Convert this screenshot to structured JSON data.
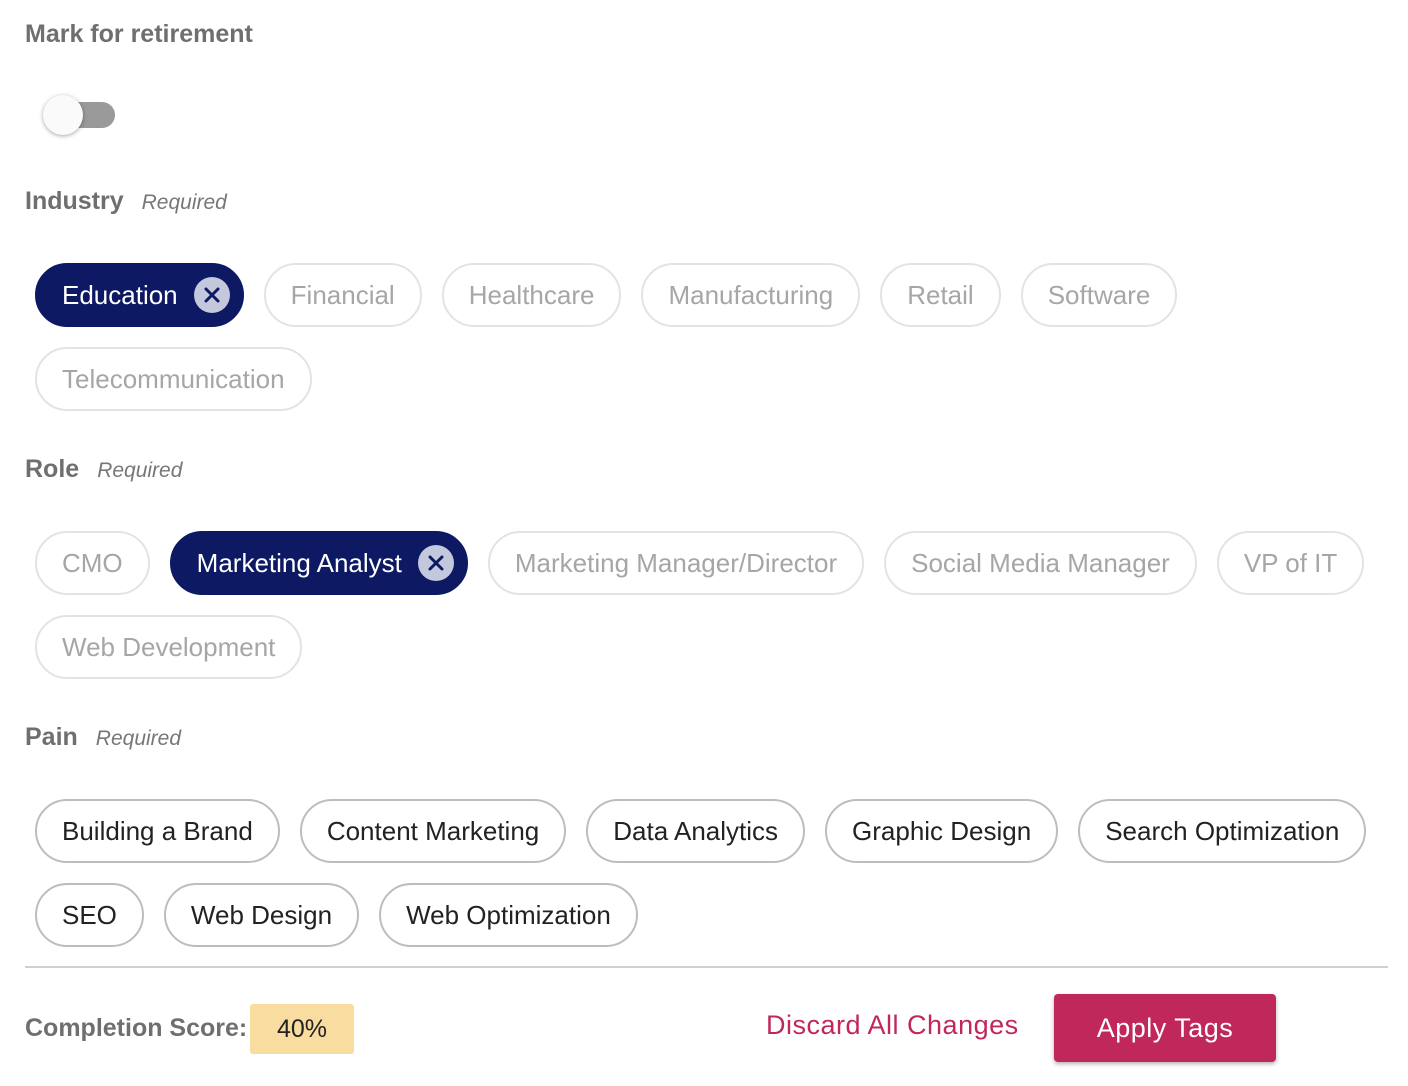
{
  "retirement": {
    "title": "Mark for retirement",
    "toggle_on": false
  },
  "industry": {
    "title": "Industry",
    "required": "Required",
    "chips": [
      {
        "label": "Education",
        "selected": true
      },
      {
        "label": "Financial",
        "selected": false
      },
      {
        "label": "Healthcare",
        "selected": false
      },
      {
        "label": "Manufacturing",
        "selected": false
      },
      {
        "label": "Retail",
        "selected": false
      },
      {
        "label": "Software",
        "selected": false
      },
      {
        "label": "Telecommunication",
        "selected": false
      }
    ]
  },
  "role": {
    "title": "Role",
    "required": "Required",
    "chips": [
      {
        "label": "CMO",
        "selected": false
      },
      {
        "label": "Marketing Analyst",
        "selected": true
      },
      {
        "label": "Marketing Manager/Director",
        "selected": false
      },
      {
        "label": "Social Media Manager",
        "selected": false
      },
      {
        "label": "VP of IT",
        "selected": false
      },
      {
        "label": "Web Development",
        "selected": false
      }
    ]
  },
  "pain": {
    "title": "Pain",
    "required": "Required",
    "chips": [
      {
        "label": "Building a Brand",
        "selected": false
      },
      {
        "label": "Content Marketing",
        "selected": false
      },
      {
        "label": "Data Analytics",
        "selected": false
      },
      {
        "label": "Graphic Design",
        "selected": false
      },
      {
        "label": "Search Optimization",
        "selected": false
      },
      {
        "label": "SEO",
        "selected": false
      },
      {
        "label": "Web Design",
        "selected": false
      },
      {
        "label": "Web Optimization",
        "selected": false
      }
    ]
  },
  "footer": {
    "score_label": "Completion Score:",
    "score_value": "40%",
    "discard_label": "Discard All Changes",
    "apply_label": "Apply Tags"
  },
  "colors": {
    "selected_chip": "#0d1a63",
    "accent": "#c0285b",
    "score_bg": "#f9dca0"
  },
  "icons": {
    "remove": "close-circle-icon"
  }
}
